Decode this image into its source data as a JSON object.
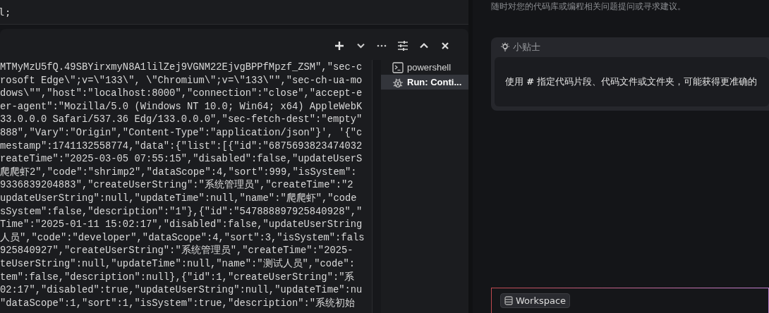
{
  "editor": {
    "lines": [
      "l;"
    ]
  },
  "terminal": {
    "toolbar": {
      "buttons": [
        {
          "kind": "plus"
        },
        {
          "kind": "caret"
        },
        {
          "kind": "more"
        },
        {
          "kind": "settings"
        },
        {
          "kind": "maximize"
        },
        {
          "kind": "close"
        }
      ]
    },
    "output": [
      "MTMyMzU5fQ.49SBYirxmyN8A1lilZej9VGNM22EjvgBPPfMpzf_ZSM\",\"sec-c",
      "rosoft Edge\\\";v=\\\"133\\\", \\\"Chromium\\\";v=\\\"133\\\"\",\"sec-ch-ua-mo",
      "dows\\\"\",\"host\":\"localhost:8000\",\"connection\":\"close\",\"accept-e",
      "er-agent\":\"Mozilla/5.0 (Windows NT 10.0; Win64; x64) AppleWebK",
      "33.0.0.0 Safari/537.36 Edg/133.0.0.0\",\"sec-fetch-dest\":\"empty\"",
      "888\",\"Vary\":\"Origin\",\"Content-Type\":\"application/json\"}', '{\"c",
      "mestamp\":1741132558774,\"data\":{\"list\":[{\"id\":\"6875693823474032",
      "reateTime\":\"2025-03-05 07:55:15\",\"disabled\":false,\"updateUserS",
      "爬爬虾2\",\"code\":\"shrimp2\",\"dataScope\":4,\"sort\":999,\"isSystem\":",
      "9336839204883\",\"createUserString\":\"系统管理员\",\"createTime\":\"2",
      "updateUserString\":null,\"updateTime\":null,\"name\":\"爬爬虾\",\"code",
      "sSystem\":false,\"description\":\"1\"},{\"id\":\"547888897925840928\",\"",
      "Time\":\"2025-01-11 15:02:17\",\"disabled\":false,\"updateUserString",
      "人员\",\"code\":\"developer\",\"dataScope\":4,\"sort\":3,\"isSystem\":fals",
      "925840927\",\"createUserString\":\"系统管理员\",\"createTime\":\"2025-",
      "teUserString\":null,\"updateTime\":null,\"name\":\"测试人员\",\"code\":",
      "tem\":false,\"description\":null},{\"id\":1,\"createUserString\":\"系",
      "02:17\",\"disabled\":true,\"updateUserString\":null,\"updateTime\":nu",
      "\"dataScope\":1,\"sort\":1,\"isSystem\":true,\"description\":\"系统初始"
    ],
    "sessions": [
      {
        "kind": "shell",
        "label": "powershell",
        "selected": false
      },
      {
        "kind": "debug",
        "label": "Run: Conti...",
        "selected": true
      }
    ]
  },
  "assistant": {
    "intro": "随时对您的代码库或编程相关问题提问或寻求建议。",
    "tip": {
      "title": "小贴士",
      "text": "使用 **#** 指定代码片段、代码文件或文件夹，可能获得更准确的"
    },
    "workspace_chip": "Workspace"
  }
}
